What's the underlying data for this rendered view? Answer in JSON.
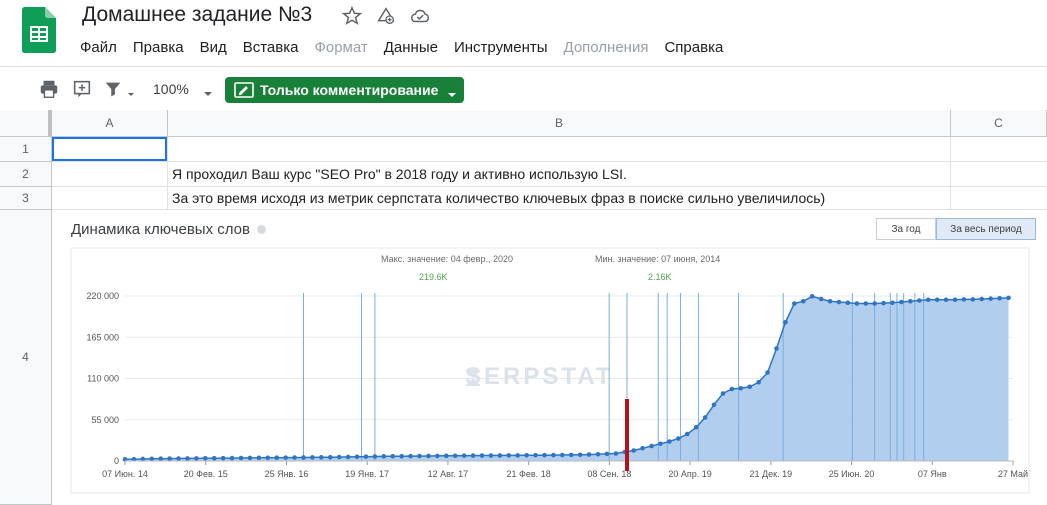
{
  "header": {
    "title": "Домашнее задание №3",
    "menu": [
      "Файл",
      "Правка",
      "Вид",
      "Вставка",
      "Формат",
      "Данные",
      "Инструменты",
      "Дополнения",
      "Справка"
    ],
    "menu_disabled": [
      "Формат",
      "Дополнения"
    ]
  },
  "toolbar": {
    "zoom": "100%",
    "comment_mode": "Только комментирование",
    "accent": "#188038"
  },
  "sheet": {
    "columns": [
      "A",
      "B",
      "C"
    ],
    "rows": [
      "1",
      "2",
      "3",
      "4"
    ],
    "cells": {
      "B2": "Я проходил Ваш курс \"SEO Pro\" в 2018 году и активно использую LSI.",
      "B3": "За это время исходя из метрик серпстата количество ключевых фраз в поиске сильно увеличилось)"
    }
  },
  "chart_panel": {
    "title": "Динамика ключевых слов",
    "buttons": [
      "За год",
      "За весь период"
    ],
    "active_button": "За весь период",
    "watermark": "SERPSTAT",
    "max_label": "Макс. значение: 04 февр., 2020",
    "max_value": "219.6K",
    "min_label": "Мин. значение: 07 июня, 2014",
    "min_value": "2.16K"
  },
  "chart_data": {
    "type": "area",
    "ylim": [
      0,
      220000
    ],
    "yticks": [
      0,
      55000,
      110000,
      165000,
      220000
    ],
    "ytick_labels": [
      "0",
      "55 000",
      "110 000",
      "165 000",
      "220 000"
    ],
    "xtick_labels": [
      "07 Июн. 14",
      "20 Фев. 15",
      "25 Янв. 16",
      "19 Янв. 17",
      "12 Авг. 17",
      "21 Фев. 18",
      "08 Сен. 18",
      "20 Апр. 19",
      "21 Дек. 19",
      "25 Июн. 20",
      "07 Янв",
      "27 Май"
    ],
    "grid": true,
    "colors": {
      "line": "#2f75c2",
      "fill": "#a9c9ec",
      "marker": "#2f75c2",
      "event": "#7aaee0",
      "highlight": "#b31217"
    },
    "points": [
      [
        0,
        2200
      ],
      [
        4,
        2400
      ],
      [
        8,
        2700
      ],
      [
        12,
        2900
      ],
      [
        16,
        3100
      ],
      [
        20,
        3200
      ],
      [
        24,
        3300
      ],
      [
        28,
        3400
      ],
      [
        32,
        3500
      ],
      [
        36,
        3600
      ],
      [
        40,
        3700
      ],
      [
        44,
        3800
      ],
      [
        48,
        3900
      ],
      [
        52,
        4000
      ],
      [
        56,
        4100
      ],
      [
        60,
        4200
      ],
      [
        64,
        4300
      ],
      [
        68,
        4400
      ],
      [
        72,
        4500
      ],
      [
        76,
        4600
      ],
      [
        80,
        4700
      ],
      [
        84,
        4800
      ],
      [
        88,
        4900
      ],
      [
        92,
        5000
      ],
      [
        96,
        5200
      ],
      [
        100,
        5400
      ],
      [
        104,
        5600
      ],
      [
        108,
        5800
      ],
      [
        112,
        6000
      ],
      [
        116,
        6200
      ],
      [
        120,
        6300
      ],
      [
        124,
        6400
      ],
      [
        128,
        6500
      ],
      [
        132,
        6600
      ],
      [
        136,
        6700
      ],
      [
        140,
        6800
      ],
      [
        144,
        6900
      ],
      [
        148,
        7000
      ],
      [
        152,
        7100
      ],
      [
        156,
        7200
      ],
      [
        160,
        7300
      ],
      [
        164,
        7300
      ],
      [
        168,
        7400
      ],
      [
        172,
        7500
      ],
      [
        176,
        7500
      ],
      [
        180,
        7600
      ],
      [
        184,
        7700
      ],
      [
        188,
        7800
      ],
      [
        192,
        7900
      ],
      [
        196,
        8000
      ],
      [
        200,
        8100
      ],
      [
        204,
        8300
      ],
      [
        208,
        8600
      ],
      [
        212,
        9000
      ],
      [
        216,
        9500
      ],
      [
        220,
        10000
      ],
      [
        224,
        12000
      ],
      [
        228,
        14000
      ],
      [
        232,
        17000
      ],
      [
        236,
        20000
      ],
      [
        240,
        23000
      ],
      [
        244,
        26000
      ],
      [
        248,
        30000
      ],
      [
        252,
        36000
      ],
      [
        256,
        45000
      ],
      [
        260,
        58000
      ],
      [
        264,
        75000
      ],
      [
        268,
        90000
      ],
      [
        272,
        96000
      ],
      [
        276,
        97000
      ],
      [
        280,
        99000
      ],
      [
        284,
        105000
      ],
      [
        288,
        118000
      ],
      [
        292,
        150000
      ],
      [
        296,
        185000
      ],
      [
        300,
        210000
      ],
      [
        304,
        213000
      ],
      [
        308,
        219600
      ],
      [
        312,
        216000
      ],
      [
        316,
        213000
      ],
      [
        320,
        212000
      ],
      [
        324,
        211000
      ],
      [
        328,
        210000
      ],
      [
        332,
        210000
      ],
      [
        336,
        210000
      ],
      [
        340,
        210500
      ],
      [
        344,
        211000
      ],
      [
        348,
        212000
      ],
      [
        352,
        213000
      ],
      [
        356,
        214000
      ],
      [
        360,
        215000
      ],
      [
        364,
        215000
      ],
      [
        368,
        215000
      ],
      [
        372,
        215000
      ],
      [
        376,
        215500
      ],
      [
        380,
        215500
      ],
      [
        384,
        216000
      ],
      [
        388,
        216500
      ],
      [
        392,
        217000
      ],
      [
        396,
        217500
      ]
    ],
    "event_lines_x": [
      80,
      106,
      112,
      217,
      225,
      239,
      243,
      249,
      257,
      275,
      295,
      326,
      336,
      343,
      346,
      349,
      354,
      358
    ],
    "highlight_x": 225,
    "x_range": [
      0,
      398
    ]
  }
}
